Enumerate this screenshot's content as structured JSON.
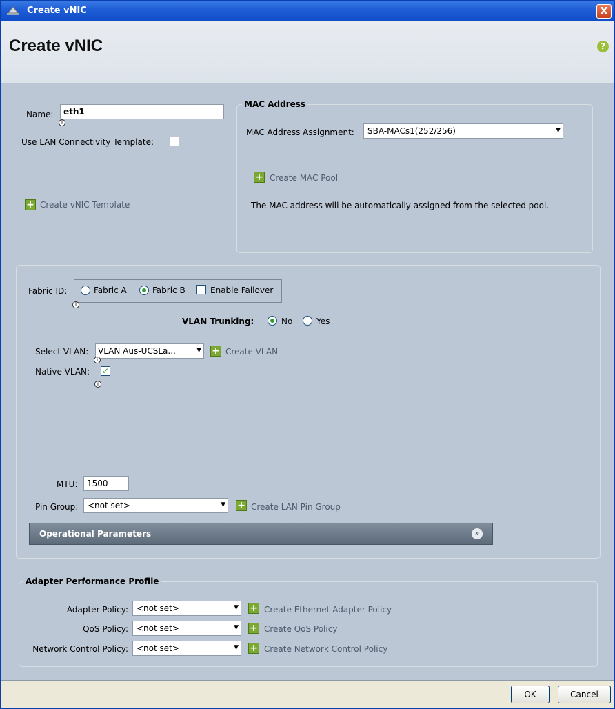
{
  "window": {
    "title": "Create vNIC",
    "close_glyph": "X"
  },
  "header": {
    "title": "Create vNIC",
    "help_glyph": "?"
  },
  "basic": {
    "name_label": "Name:",
    "name_value": "eth1",
    "use_lan_template_label": "Use LAN Connectivity Template:",
    "use_lan_template_checked": false,
    "create_vnic_template": "Create vNIC Template"
  },
  "mac": {
    "legend": "MAC Address",
    "assignment_label": "MAC Address Assignment:",
    "assignment_value": "SBA-MACs1(252/256)",
    "create_pool": "Create MAC Pool",
    "note": "The MAC address will be automatically assigned from the selected pool."
  },
  "fabric": {
    "label": "Fabric ID:",
    "options": [
      {
        "label": "Fabric A",
        "selected": false
      },
      {
        "label": "Fabric B",
        "selected": true
      }
    ],
    "enable_failover_label": "Enable Failover",
    "enable_failover_checked": false
  },
  "vlan": {
    "trunking_label": "VLAN Trunking:",
    "trunking_options": [
      {
        "label": "No",
        "selected": true
      },
      {
        "label": "Yes",
        "selected": false
      }
    ],
    "select_label": "Select VLAN:",
    "select_value": "VLAN Aus-UCSLa...",
    "create_vlan": "Create VLAN",
    "native_label": "Native VLAN:",
    "native_checked": true
  },
  "mtu": {
    "label": "MTU:",
    "value": "1500"
  },
  "pin_group": {
    "label": "Pin Group:",
    "value": "<not set>",
    "create": "Create LAN Pin Group"
  },
  "operational": {
    "title": "Operational Parameters",
    "expand_glyph": "»"
  },
  "adapter": {
    "legend": "Adapter Performance Profile",
    "rows": [
      {
        "label": "Adapter Policy:",
        "value": "<not set>",
        "create": "Create Ethernet Adapter Policy"
      },
      {
        "label": "QoS Policy:",
        "value": "<not set>",
        "create": "Create QoS Policy"
      },
      {
        "label": "Network Control Policy:",
        "value": "<not set>",
        "create": "Create Network Control Policy"
      }
    ]
  },
  "footer": {
    "ok": "OK",
    "cancel": "Cancel"
  },
  "icons": {
    "add": "+",
    "dropdown": "▼",
    "info": "i",
    "check": "✓"
  },
  "colors": {
    "titlebar": "#1f5fd6",
    "panel": "#bcc7d6",
    "add_green": "#7aa832"
  }
}
